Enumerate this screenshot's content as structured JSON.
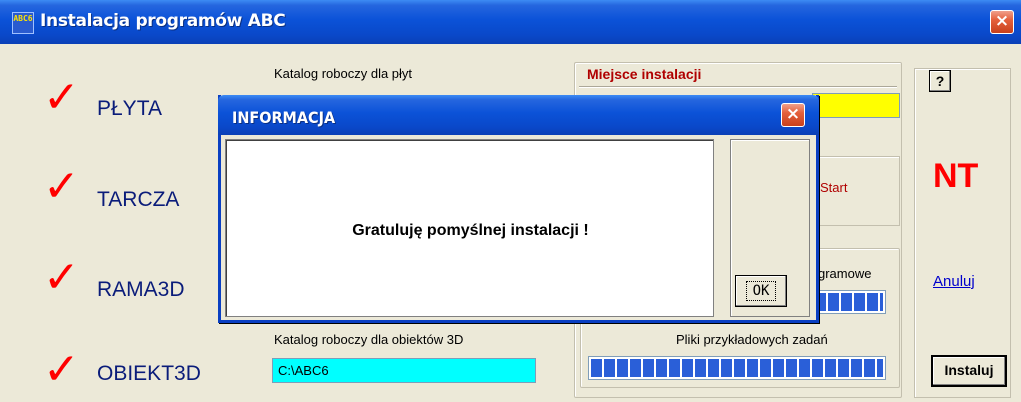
{
  "window": {
    "icon_text": "ABC6",
    "title": "Instalacja programów ABC",
    "close_label": "×"
  },
  "programs": [
    {
      "check": "✓",
      "label": "PŁYTA"
    },
    {
      "check": "✓",
      "label": "TARCZA"
    },
    {
      "check": "✓",
      "label": "RAMA3D"
    },
    {
      "check": "✓",
      "label": "OBIEKT3D"
    }
  ],
  "work_dirs": {
    "plates_label": "Katalog roboczy dla płyt",
    "objects_label": "Katalog roboczy dla obiektów 3D",
    "objects_value": "C:\\ABC6"
  },
  "install_location": {
    "label": "Miejsce instalacji",
    "value": ""
  },
  "start_menu": {
    "label": "Start"
  },
  "files": {
    "program_files_label": "gramowe",
    "program_files_progress": 1.0,
    "examples_label": "Pliki przykładowych zadań",
    "examples_progress": 1.0
  },
  "side": {
    "help_label": "?",
    "os_badge": "NT",
    "cancel_label": "Anuluj",
    "install_label": "Instaluj"
  },
  "dialog": {
    "title": "INFORMACJA",
    "close_label": "×",
    "message": "Gratuluję pomyślnej instalacji !",
    "ok_label": "OK"
  },
  "colors": {
    "check": "#ff0000",
    "program_label": "#0a1c7a",
    "field_cyan": "#00ffff",
    "field_yellow": "#ffff00",
    "progress": "#2a5fd8",
    "titlebar": "#0b52d8"
  }
}
